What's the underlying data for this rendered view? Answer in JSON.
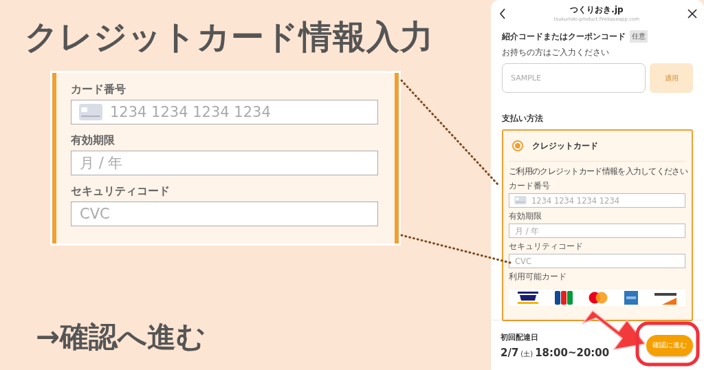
{
  "promo_title": "クレジットカード情報入力",
  "zoom_panel": {
    "fields": [
      {
        "label": "カード番号",
        "placeholder": "1234 1234 1234 1234",
        "kind": "card"
      },
      {
        "label": "有効期限",
        "placeholder": "月 / 年",
        "kind": "text"
      },
      {
        "label": "セキュリティコード",
        "placeholder": "CVC",
        "kind": "text"
      }
    ]
  },
  "caption": "→確認へ進む",
  "phone": {
    "header": {
      "title": "つくりおき.jp",
      "url": "tsukurioki-product.firebaseapp.com"
    },
    "coupon": {
      "title": "紹介コードまたはクーポンコード",
      "badge": "任意",
      "hint": "お持ちの方はご入力ください",
      "placeholder": "SAMPLE",
      "apply_button": {
        "label": "適用",
        "disabled": true
      }
    },
    "payment": {
      "title": "支払い方法",
      "methods": [
        {
          "label": "クレジットカード",
          "selected": true
        }
      ],
      "instruction": "ご利用のクレジットカード情報を入力してください",
      "fields": [
        {
          "label": "カード番号",
          "placeholder": "1234 1234 1234 1234",
          "kind": "card"
        },
        {
          "label": "有効期限",
          "placeholder": "月 / 年",
          "kind": "text"
        },
        {
          "label": "セキュリティコード",
          "placeholder": "CVC",
          "kind": "text"
        }
      ],
      "accepted_label": "利用可能カード",
      "brands": [
        {
          "kind": "visa"
        },
        {
          "kind": "jcb"
        },
        {
          "kind": "mastercard"
        },
        {
          "kind": "amex"
        },
        {
          "kind": "discover"
        }
      ]
    },
    "footer": {
      "label": "初回配達日",
      "date": "2/7",
      "weekday": "(土)",
      "time": "18:00~20:00",
      "confirm_button": "確認に進む"
    }
  }
}
